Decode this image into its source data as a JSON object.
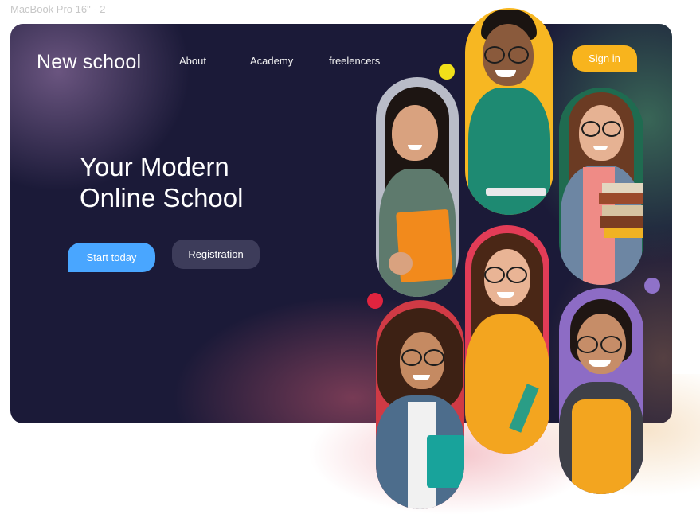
{
  "frame_label": "MacBook Pro 16\" - 2",
  "brand": "New school",
  "nav": {
    "about": "About",
    "academy": "Academy",
    "freelencers": "freelencers"
  },
  "signin_label": "Sign in",
  "hero": {
    "line1": "Your Modern",
    "line2": "Online School"
  },
  "buttons": {
    "start": "Start today",
    "register": "Registration"
  },
  "colors": {
    "card_bg": "#1b1a38",
    "primary_blue": "#49a6ff",
    "accent_yellow": "#f8b41d",
    "secondary_button": "#3d3c5a",
    "dot_yellow": "#f1e01a",
    "dot_red": "#e0243f",
    "dot_purple": "#8f72c9"
  },
  "photos": [
    {
      "name": "student-photo-book-girl",
      "bg": "#b9bcc8"
    },
    {
      "name": "student-photo-glasses-boy",
      "bg": "#f7b722"
    },
    {
      "name": "student-photo-books-girl",
      "bg": "#1f6b50"
    },
    {
      "name": "student-photo-curly-girl",
      "bg": "#d03a45"
    },
    {
      "name": "student-photo-yellow-sweater-girl",
      "bg": "#e23c57"
    },
    {
      "name": "student-photo-smiling-girl",
      "bg": "#8d6cc5"
    }
  ]
}
